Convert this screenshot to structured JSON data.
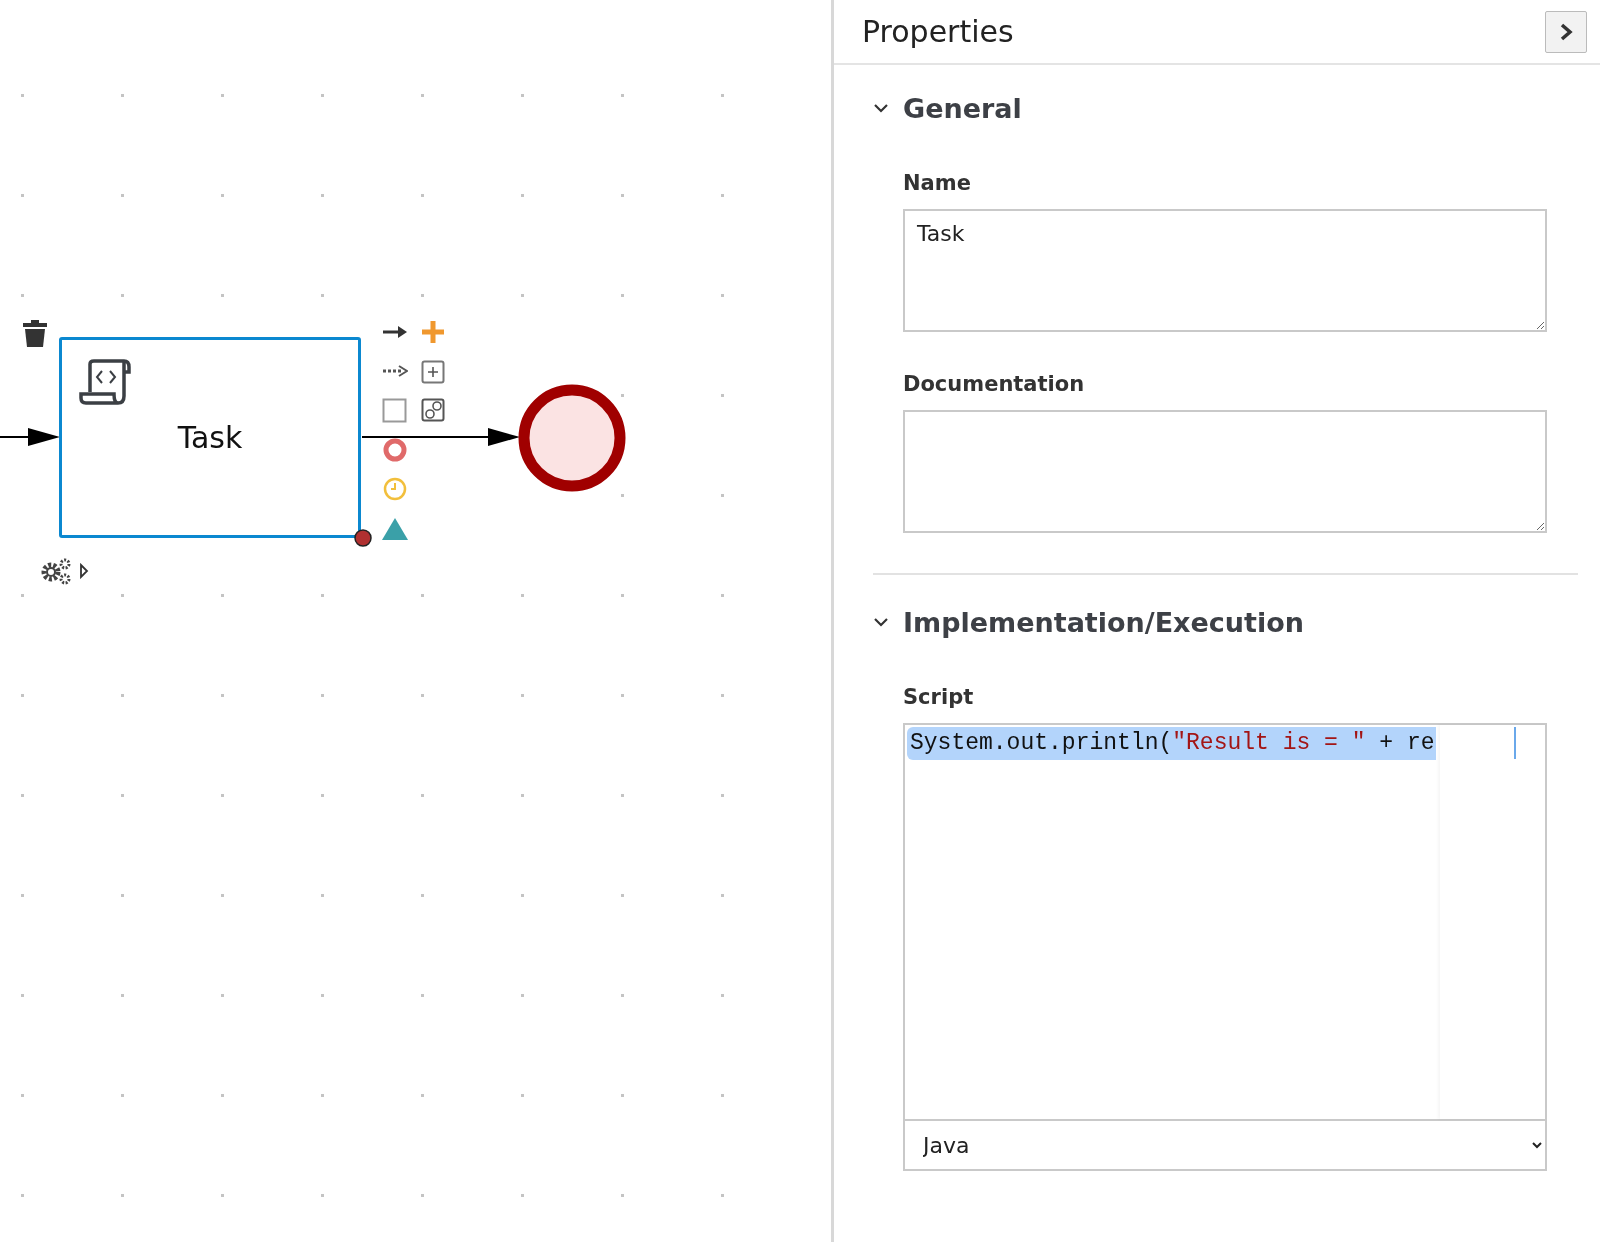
{
  "diagram": {
    "task": {
      "name": "Task",
      "selected": true
    }
  },
  "properties": {
    "title": "Properties",
    "sections": [
      {
        "title": "General",
        "expanded": true,
        "fields": [
          {
            "label": "Name",
            "value": "Task"
          },
          {
            "label": "Documentation"
          }
        ]
      },
      {
        "title": "Implementation/Execution",
        "expanded": true,
        "script": {
          "label": "Script",
          "tokens": [
            {
              "kind": "plain",
              "text": "System.out.println("
            },
            {
              "kind": "string",
              "text": "\"Result is = \""
            },
            {
              "kind": "plain",
              "text": " + re"
            }
          ],
          "language": "Java"
        }
      }
    ]
  }
}
